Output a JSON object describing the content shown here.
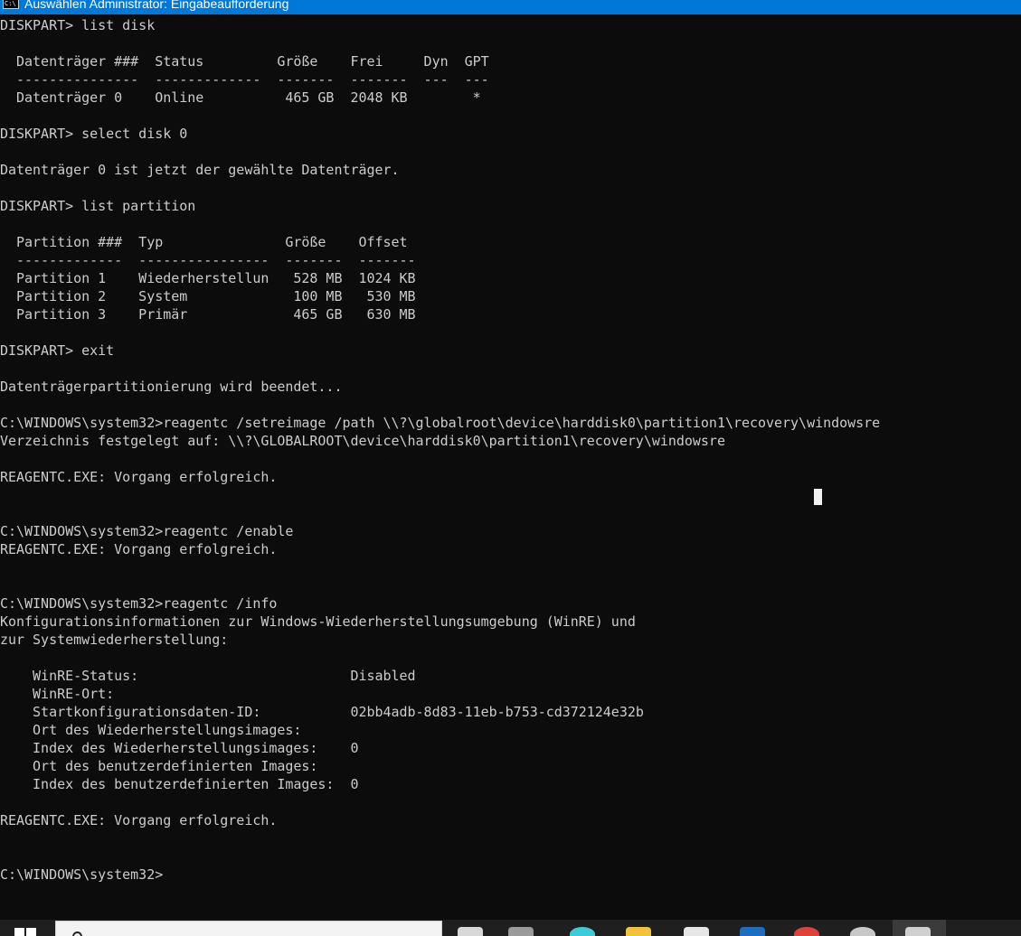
{
  "window": {
    "title": "Auswählen Administrator: Eingabeaufforderung",
    "icon_label": "C:\\"
  },
  "console": {
    "lines": [
      "DISKPART> list disk",
      "",
      "  Datenträger ###  Status         Größe    Frei     Dyn  GPT",
      "  ---------------  -------------  -------  -------  ---  ---",
      "  Datenträger 0    Online          465 GB  2048 KB        *",
      "",
      "DISKPART> select disk 0",
      "",
      "Datenträger 0 ist jetzt der gewählte Datenträger.",
      "",
      "DISKPART> list partition",
      "",
      "  Partition ###  Typ               Größe    Offset",
      "  -------------  ----------------  -------  -------",
      "  Partition 1    Wiederherstellun   528 MB  1024 KB",
      "  Partition 2    System             100 MB   530 MB",
      "  Partition 3    Primär             465 GB   630 MB",
      "",
      "DISKPART> exit",
      "",
      "Datenträgerpartitionierung wird beendet...",
      "",
      "C:\\WINDOWS\\system32>reagentc /setreimage /path \\\\?\\globalroot\\device\\harddisk0\\partition1\\recovery\\windowsre",
      "Verzeichnis festgelegt auf: \\\\?\\GLOBALROOT\\device\\harddisk0\\partition1\\recovery\\windowsre",
      "",
      "REAGENTC.EXE: Vorgang erfolgreich.",
      "",
      "",
      "C:\\WINDOWS\\system32>reagentc /enable",
      "REAGENTC.EXE: Vorgang erfolgreich.",
      "",
      "",
      "C:\\WINDOWS\\system32>reagentc /info",
      "Konfigurationsinformationen zur Windows-Wiederherstellungsumgebung (WinRE) und",
      "zur Systemwiederherstellung:",
      "",
      "    WinRE-Status:                          Disabled",
      "    WinRE-Ort:",
      "    Startkonfigurationsdaten-ID:           02bb4adb-8d83-11eb-b753-cd372124e32b",
      "    Ort des Wiederherstellungsimages:",
      "    Index des Wiederherstellungsimages:    0",
      "    Ort des benutzerdefinierten Images:",
      "    Index des benutzerdefinierten Images:  0",
      "",
      "REAGENTC.EXE: Vorgang erfolgreich.",
      "",
      "",
      "C:\\WINDOWS\\system32>"
    ]
  },
  "colors": {
    "titlebar": "#0078d7",
    "console_bg": "#0c0c0c",
    "console_fg": "#cccccc",
    "taskbar": "#1f1f1f"
  },
  "taskbar": {
    "icons": [
      {
        "name": "task-view-icon",
        "color": "#d8d8d8"
      },
      {
        "name": "app-pinned-1-icon",
        "color": "#9a9a9a"
      },
      {
        "name": "edge-icon",
        "color": "#3ccbd8"
      },
      {
        "name": "file-explorer-icon",
        "color": "#f2c23a"
      },
      {
        "name": "phone-link-icon",
        "color": "#e6e6e6"
      },
      {
        "name": "store-icon",
        "color": "#1b6ec2"
      },
      {
        "name": "chrome-icon",
        "color": "#e0413a"
      },
      {
        "name": "app-pinned-2-icon",
        "color": "#c8c8c8"
      },
      {
        "name": "command-prompt-icon",
        "color": "#d0d0d0"
      }
    ]
  }
}
